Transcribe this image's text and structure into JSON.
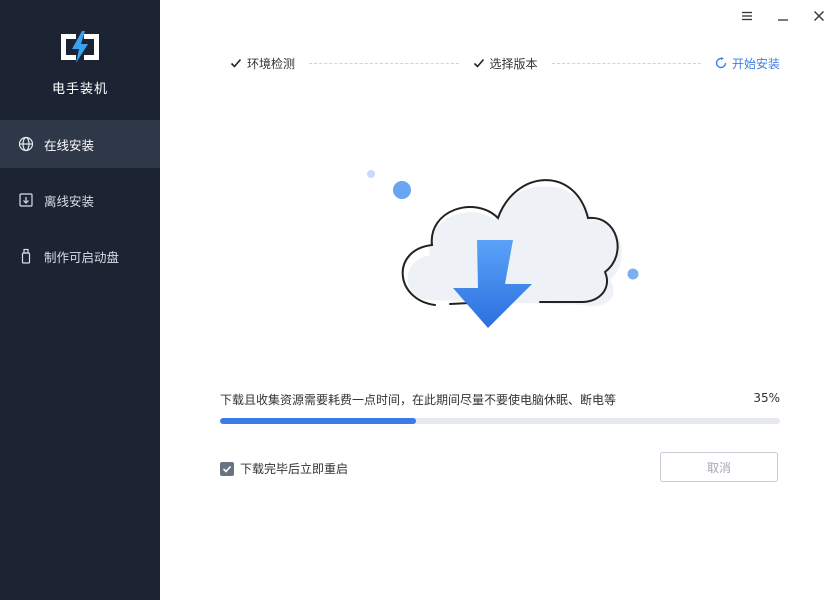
{
  "app": {
    "title": "电手装机"
  },
  "sidebar": {
    "items": [
      {
        "label": "在线安装",
        "icon": "globe-icon",
        "active": true
      },
      {
        "label": "离线安装",
        "icon": "download-box-icon",
        "active": false
      },
      {
        "label": "制作可启动盘",
        "icon": "usb-drive-icon",
        "active": false
      }
    ]
  },
  "window": {
    "controls": [
      "menu-icon",
      "minimize-icon",
      "close-icon"
    ]
  },
  "steps": [
    {
      "label": "环境检测",
      "status": "done"
    },
    {
      "label": "选择版本",
      "status": "done"
    },
    {
      "label": "开始安装",
      "status": "current"
    }
  ],
  "progress": {
    "message": "下载且收集资源需要耗费一点时间，在此期间尽量不要使电脑休眠、断电等",
    "percent_label": "35%",
    "value": 0.35
  },
  "options": {
    "restart_label": "下载完毕后立即重启",
    "restart_checked": true
  },
  "actions": {
    "cancel_label": "取消"
  },
  "colors": {
    "sidebar_bg": "#1c2433",
    "sidebar_active": "#2f3848",
    "accent": "#3a7be6"
  }
}
